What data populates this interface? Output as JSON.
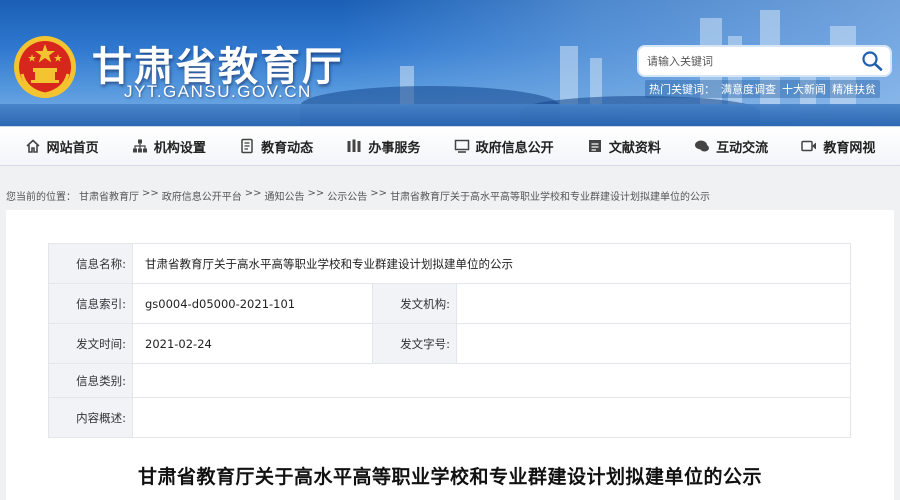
{
  "site": {
    "title": "甘肃省教育厅",
    "domain": "JYT.GANSU.GOV.CN"
  },
  "search": {
    "placeholder": "请输入关键词",
    "hot_label": "热门关键词：",
    "keywords": [
      "满意度调查",
      "十大新闻",
      "精准扶贫"
    ]
  },
  "nav": {
    "items": [
      {
        "label": "网站首页",
        "icon": "home-icon"
      },
      {
        "label": "机构设置",
        "icon": "org-icon"
      },
      {
        "label": "教育动态",
        "icon": "news-icon"
      },
      {
        "label": "办事服务",
        "icon": "service-icon"
      },
      {
        "label": "政府信息公开",
        "icon": "monitor-icon"
      },
      {
        "label": "文献资料",
        "icon": "document-icon"
      },
      {
        "label": "互动交流",
        "icon": "chat-icon"
      },
      {
        "label": "教育网视",
        "icon": "video-icon"
      }
    ]
  },
  "breadcrumb": {
    "prefix": "您当前的位置：",
    "items": [
      "甘肃省教育厅",
      "政府信息公开平台",
      "通知公告",
      "公示公告",
      "甘肃省教育厅关于高水平高等职业学校和专业群建设计划拟建单位的公示"
    ],
    "sep": ">>"
  },
  "info": {
    "name_label": "信息名称:",
    "name_value": "甘肃省教育厅关于高水平高等职业学校和专业群建设计划拟建单位的公示",
    "index_label": "信息索引:",
    "index_value": "gs0004-d05000-2021-101",
    "issuer_label": "发文机构:",
    "issuer_value": "",
    "date_label": "发文时间:",
    "date_value": "2021-02-24",
    "docno_label": "发文字号:",
    "docno_value": "",
    "category_label": "信息类别:",
    "category_value": "",
    "summary_label": "内容概述:",
    "summary_value": ""
  },
  "article": {
    "title": "甘肃省教育厅关于高水平高等职业学校和专业群建设计划拟建单位的公示"
  },
  "colors": {
    "banner_blue": "#2f78cf",
    "emblem_red": "#d7261b",
    "emblem_gold": "#f4c430",
    "nav_icon": "#444444"
  }
}
